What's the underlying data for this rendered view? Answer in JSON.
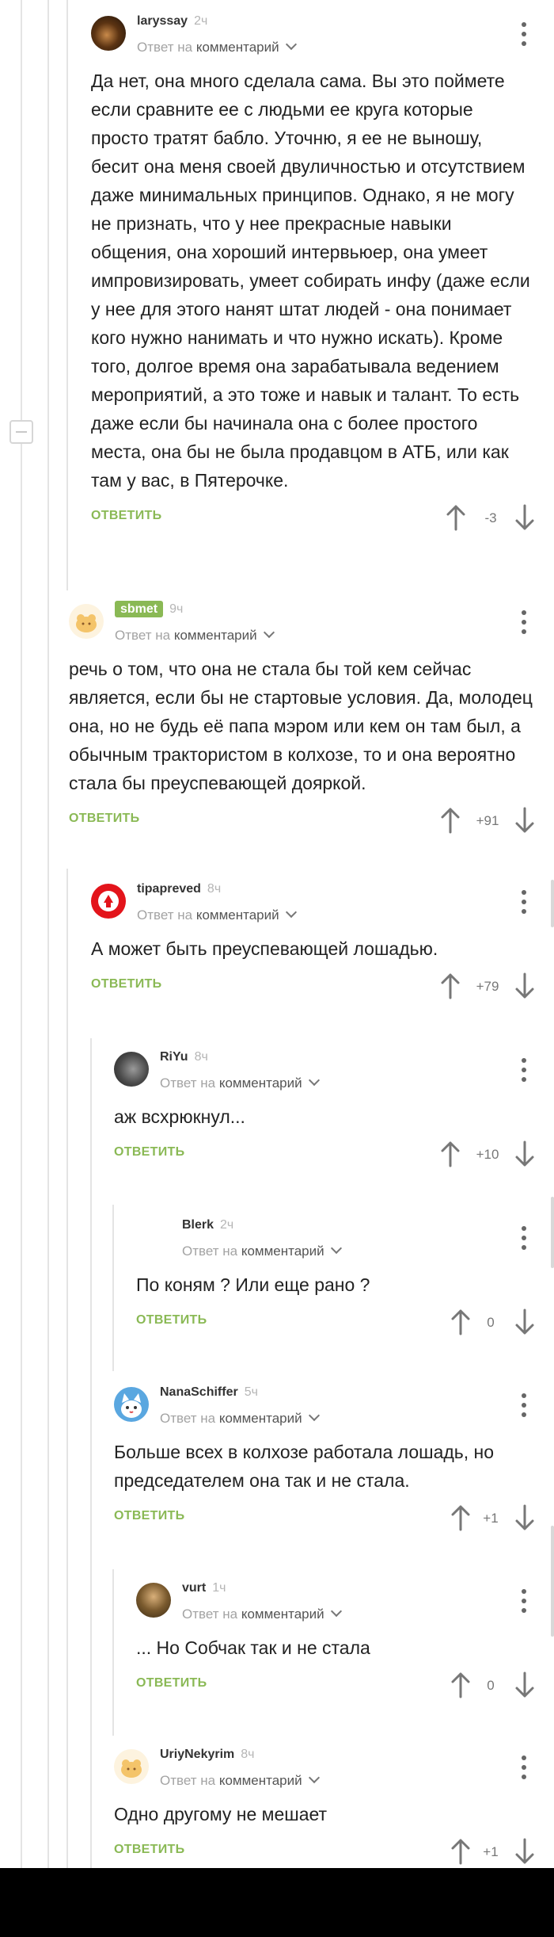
{
  "ui": {
    "reply_to_prefix": "Ответ на",
    "reply_to_target": "комментарий",
    "reply_button": "ОТВЕТИТЬ"
  },
  "comments": [
    {
      "user": "laryssay",
      "time": "2ч",
      "score": "-3",
      "text": "Да нет, она много сделала сама. Вы это поймете если сравните ее с людьми ее круга которые просто тратят  бабло. Уточню, я ее не выношу, бесит она меня своей двуличностью и отсутствием даже минимальных принципов. Однако, я не могу не признать, что у нее прекрасные навыки общения, она хороший интервьюер,  она умеет импровизировать, умеет собирать инфу (даже если у нее для этого нанят штат людей - она понимает кого нужно нанимать и что нужно искать). Кроме того, долгое время она зарабатывала ведением мероприятий, а это тоже и навык и талант. То есть даже если бы начинала она с более простого места, она бы не была продавцом в АТБ, или как там у вас, в Пятерочке."
    },
    {
      "user": "sbmet",
      "time": "9ч",
      "score": "+91",
      "text": "речь о том, что она не стала бы той кем сейчас является, если бы не стартовые условия. Да, молодец она, но не будь её папа мэром или кем он там был, а обычным трактористом в колхозе, то и она вероятно стала бы преуспевающей дояркой."
    },
    {
      "user": "tipapreved",
      "time": "8ч",
      "score": "+79",
      "text": "А может быть преуспевающей лошадью."
    },
    {
      "user": "RiYu",
      "time": "8ч",
      "score": "+10",
      "text": "аж всхрюкнул..."
    },
    {
      "user": "Blerk",
      "time": "2ч",
      "score": "0",
      "text": "По коням ? Или еще рано ?"
    },
    {
      "user": "NanaSchiffer",
      "time": "5ч",
      "score": "+1",
      "text": "Больше всех в колхозе работала лошадь, но председателем она так и не стала."
    },
    {
      "user": "vurt",
      "time": "1ч",
      "score": "0",
      "text": "... Но Собчак так и не стала"
    },
    {
      "user": "UriyNekyrim",
      "time": "8ч",
      "score": "+1",
      "text": "Одно другому не мешает"
    }
  ],
  "colors": {
    "accent": "#8ab955",
    "thread_line": "#e4e4e4",
    "muted": "#a3a3a3"
  }
}
